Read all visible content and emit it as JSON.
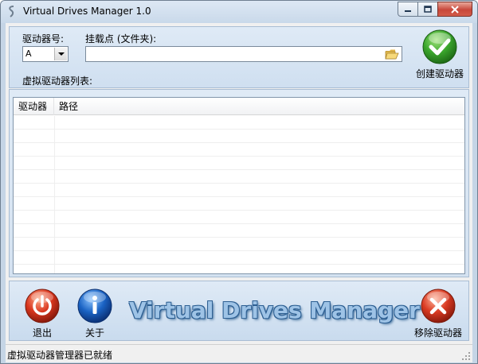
{
  "window": {
    "title": "Virtual Drives Manager 1.0"
  },
  "top_panel": {
    "drive_label": "驱动器号:",
    "drive_value": "A",
    "mount_label": "挂载点 (文件夹):",
    "mount_value": "",
    "list_label": "虚拟驱动器列表:",
    "create_button": "创建驱动器"
  },
  "list": {
    "columns": [
      "驱动器",
      "路径"
    ],
    "rows": []
  },
  "bottom_panel": {
    "exit_button": "退出",
    "about_button": "关于",
    "banner": "Virtual Drives Manager",
    "remove_button": "移除驱动器"
  },
  "status": {
    "text": "虚拟驱动器管理器已就绪"
  },
  "colors": {
    "panel": "#d4e2f1",
    "create": "#3aa62c",
    "exit": "#d9361e",
    "about": "#1a63c4",
    "remove": "#d93a22",
    "banner": "#9ec3e6"
  }
}
